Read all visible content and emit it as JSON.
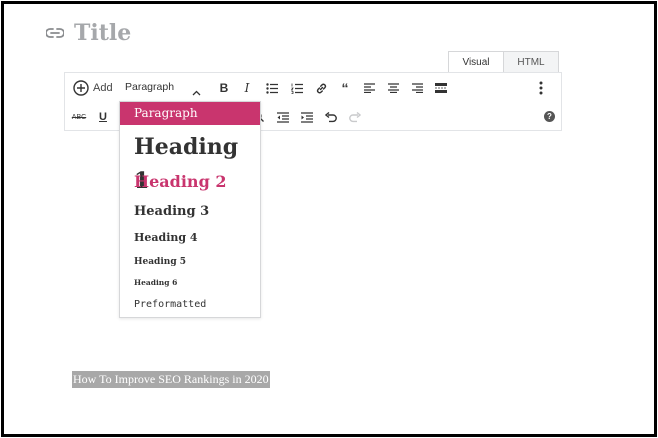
{
  "post": {
    "title": "Title"
  },
  "tabs": [
    {
      "label": "Visual",
      "active": true
    },
    {
      "label": "HTML",
      "active": false
    }
  ],
  "toolbar": {
    "add_label": "Add",
    "format_select": "Paragraph",
    "help_label": "?"
  },
  "format_menu": {
    "items": [
      {
        "label": "Paragraph",
        "selected": true
      },
      {
        "label": "Heading 1"
      },
      {
        "label": "Heading 2"
      },
      {
        "label": "Heading 3"
      },
      {
        "label": "Heading 4"
      },
      {
        "label": "Heading 5"
      },
      {
        "label": "Heading 6"
      },
      {
        "label": "Preformatted"
      }
    ],
    "accent_color": "#c9356e"
  },
  "content": {
    "selected_text": "How To Improve SEO Rankings in 2020"
  }
}
